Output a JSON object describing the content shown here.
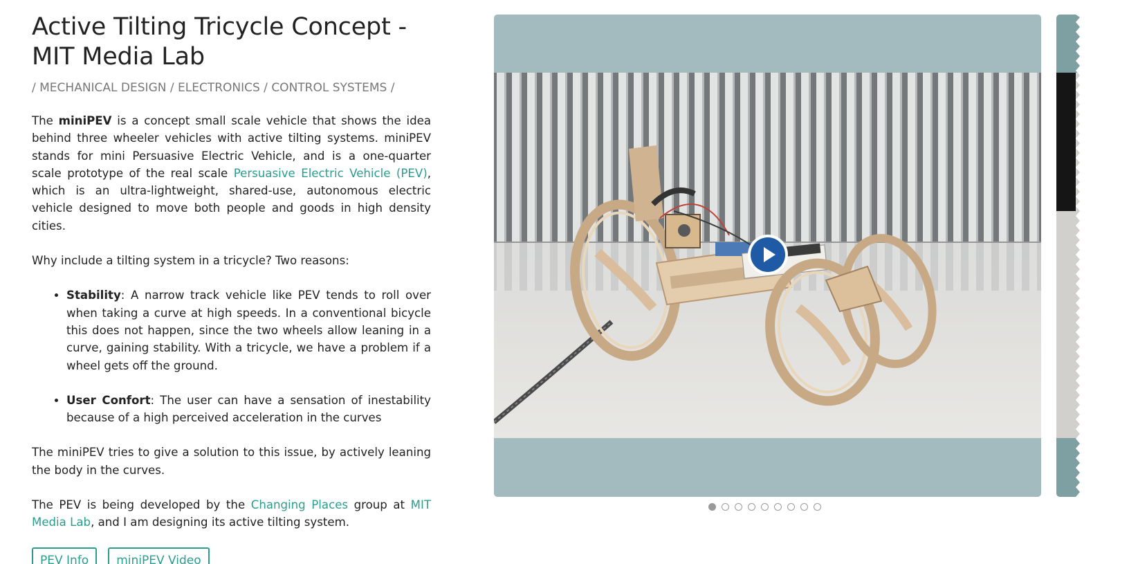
{
  "project": {
    "title_line1": "Active Tilting Tricycle Concept -",
    "title_line2": "MIT Media Lab",
    "categories": "/ MECHANICAL DESIGN / ELECTRONICS / CONTROL SYSTEMS /"
  },
  "intro": {
    "part1": "The ",
    "bold1": "miniPEV",
    "part2": " is a concept small scale vehicle that shows the idea behind three wheeler vehicles with active tilting systems. miniPEV stands for mini Persuasive Electric Vehicle, and is a one-quarter scale prototype of the real scale ",
    "link1": "Persuasive Electric Vehicle (PEV)",
    "part3": ", which is an ultra-lightweight, shared-use, autonomous electric vehicle designed to move both people and goods in high density cities."
  },
  "why": "Why include a tilting system in a tricycle? Two reasons:",
  "reasons": [
    {
      "term": "Stability",
      "text": ": A narrow track vehicle like PEV tends to roll over when taking a curve at high speeds. In a conventional bicycle this does not happen, since the two wheels allow leaning in a curve, gaining stability. With a tricycle, we have a problem if a wheel gets off the ground."
    },
    {
      "term": "User Confort",
      "text": ": The user can have a sensation of inestability because of a high perceived acceleration in the curves"
    }
  ],
  "solution": "The miniPEV tries to give a solution to this issue, by actively leaning the body in the curves.",
  "dev": {
    "part1": "The PEV is being developed by the ",
    "link1": "Changing Places",
    "part2": " group at ",
    "link2": "MIT Media Lab",
    "part3": ", and I am designing its active tilting system."
  },
  "buttons": {
    "pev_info": "PEV Info",
    "minipev_video": "miniPEV Video"
  },
  "carousel": {
    "play_icon": "play-icon",
    "dot_count": 9,
    "active_dot": 1
  },
  "colors": {
    "accent": "#2a9d8f",
    "slide_bg": "#a3bbbf",
    "play_button": "#1e5aa6"
  }
}
